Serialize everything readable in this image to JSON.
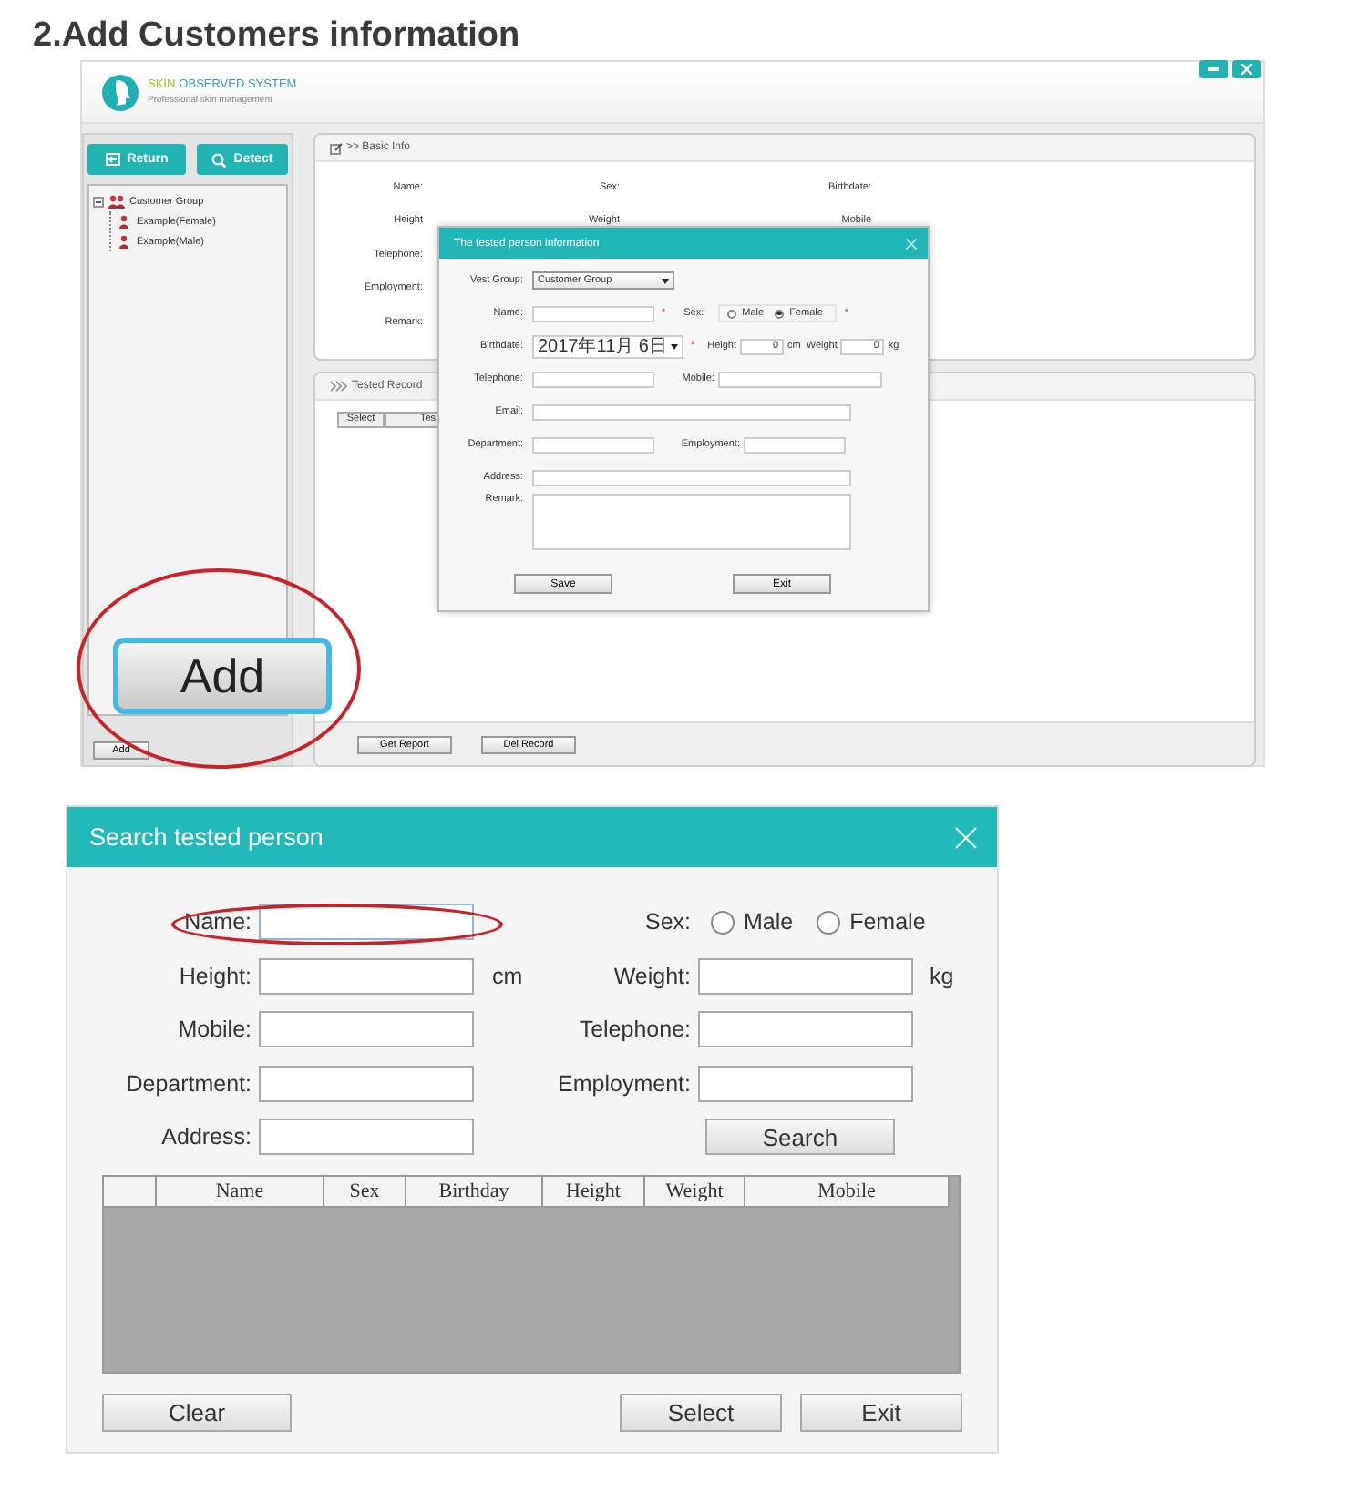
{
  "heading": "2.Add Customers information",
  "main_window": {
    "brand": {
      "highlight": "SKIN",
      "rest": "OBSERVED SYSTEM",
      "subtitle": "Professional skin management"
    },
    "sidebar": {
      "buttons": [
        {
          "kind": "return",
          "label": "Return"
        },
        {
          "kind": "detect",
          "label": "Detect"
        }
      ],
      "tree": [
        {
          "label": "Customer Group",
          "expanded": true,
          "children": [
            {
              "label": "Example(Female)"
            },
            {
              "label": "Example(Male)"
            }
          ]
        }
      ],
      "add_button": "Add"
    },
    "basic_info": {
      "title": ">> Basic Info",
      "rows": [
        [
          "Name:",
          "Sex:",
          "Birthdate:"
        ],
        [
          "Height",
          "Weight",
          "Mobile"
        ],
        [
          "Telephone:"
        ],
        [
          "Employment:"
        ],
        [
          "Remark:"
        ]
      ]
    },
    "tested_record": {
      "title": "Tested Record",
      "columns": [
        "Select",
        "Tes"
      ],
      "buttons": [
        "Get Report",
        "Del Record"
      ]
    }
  },
  "person_dialog": {
    "title": "The tested person information",
    "vest_group": {
      "label": "Vest Group:",
      "value": "Customer Group"
    },
    "name": {
      "label": "Name:",
      "required": "*"
    },
    "sex": {
      "label": "Sex:",
      "required": "*",
      "options": [
        {
          "label": "Male",
          "selected": false
        },
        {
          "label": "Female",
          "selected": true
        }
      ]
    },
    "birthdate": {
      "label": "Birthdate:",
      "value": "2017年11月 6日",
      "required": "*"
    },
    "height": {
      "label": "Height",
      "value": "0",
      "unit": "cm"
    },
    "weight": {
      "label": "Weight",
      "value": "0",
      "unit": "kg"
    },
    "telephone": {
      "label": "Telephone:"
    },
    "mobile": {
      "label": "Mobile:"
    },
    "email": {
      "label": "Email:"
    },
    "department": {
      "label": "Department:"
    },
    "employment": {
      "label": "Employment:"
    },
    "address": {
      "label": "Address:"
    },
    "remark": {
      "label": "Remark:"
    },
    "buttons": [
      "Save",
      "Exit"
    ]
  },
  "callout": {
    "button": "Add"
  },
  "search_dialog": {
    "title": "Search tested person",
    "name": {
      "label": "Name:"
    },
    "sex": {
      "label": "Sex:",
      "options": [
        {
          "label": "Male",
          "selected": false
        },
        {
          "label": "Female",
          "selected": false
        }
      ]
    },
    "height": {
      "label": "Height:",
      "unit": "cm"
    },
    "weight": {
      "label": "Weight:",
      "unit": "kg"
    },
    "mobile": {
      "label": "Mobile:"
    },
    "telephone": {
      "label": "Telephone:"
    },
    "department": {
      "label": "Department:"
    },
    "employment": {
      "label": "Employment:"
    },
    "address": {
      "label": "Address:"
    },
    "search_button": "Search",
    "table": {
      "columns": [
        "Name",
        "Sex",
        "Birthday",
        "Height",
        "Weight",
        "Mobile"
      ]
    },
    "buttons": [
      "Clear",
      "Select",
      "Exit"
    ]
  }
}
